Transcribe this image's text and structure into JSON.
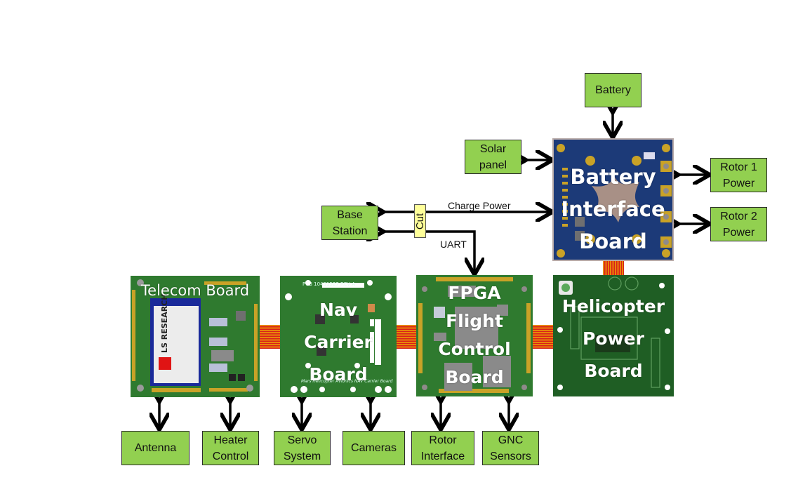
{
  "diagram": {
    "external_blocks": {
      "battery": "Battery",
      "solar_panel": "Solar\npanel",
      "rotor1_power": "Rotor 1\nPower",
      "rotor2_power": "Rotor 2\nPower",
      "base_station": "Base\nStation",
      "antenna": "Antenna",
      "heater_control": "Heater\nControl",
      "servo_system": "Servo\nSystem",
      "cameras": "Cameras",
      "rotor_interface": "Rotor\nInterface",
      "gnc_sensors": "GNC\nSensors"
    },
    "boards": {
      "battery_interface": "Battery\nInterface\nBoard",
      "telecom": "Telecom Board",
      "nav_carrier": "Nav\nCarrier\nBoard",
      "fpga_flight_control": "FPGA\nFlight\nControl\nBoard",
      "helicopter_power": "Helicopter\nPower\nBoard"
    },
    "board_silkscreen": {
      "telecom_module": "LS RESEARCH",
      "nav_pcb": "PCB  10431527   REV A",
      "nav_footer": "Mars Helicopter Avionics NAV Carrier Board"
    },
    "connection_labels": {
      "charge_power": "Charge Power",
      "uart": "UART",
      "cut": "Cut"
    },
    "colors": {
      "block_fill": "#92d050",
      "battery_board": "#1c3a78",
      "green_board": "#2f7a2f",
      "helicopter_board": "#1f5e24",
      "cut_fill": "#ffff99",
      "flex_cable": "#e8850a"
    }
  }
}
